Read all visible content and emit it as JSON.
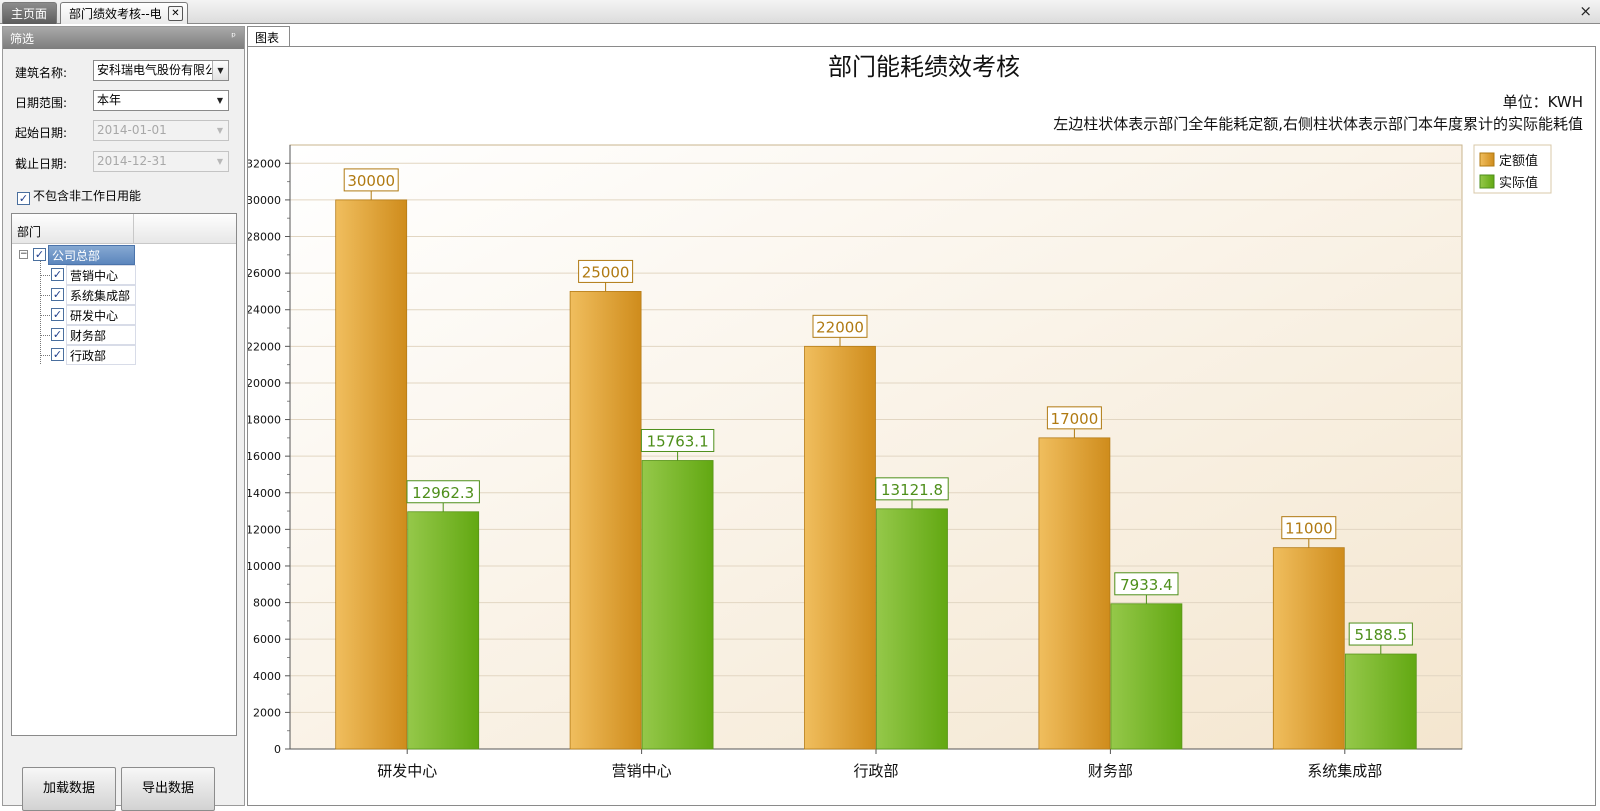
{
  "tabs": {
    "home": "主页面",
    "current": "部门绩效考核--电",
    "close_glyph": "✕",
    "window_close_glyph": "×"
  },
  "filter": {
    "title": "筛选",
    "pin_glyph": "ᵖ",
    "building_label": "建筑名称:",
    "building_value": "安科瑞电气股份有限公",
    "range_label": "日期范围:",
    "range_value": "本年",
    "start_label": "起始日期:",
    "start_value": "2014-01-01",
    "end_label": "截止日期:",
    "end_value": "2014-12-31",
    "exclude_label": "不包含非工作日用能",
    "exclude_checked": "✓"
  },
  "tree": {
    "column_header": "部门",
    "root": "公司总部",
    "children": [
      "营销中心",
      "系统集成部",
      "研发中心",
      "财务部",
      "行政部"
    ],
    "check_glyph": "✓",
    "collapse_glyph": "−"
  },
  "buttons": {
    "load": "加载数据",
    "export": "导出数据"
  },
  "chart_tab": "图表",
  "colors": {
    "quota": "#e0a33a",
    "actual": "#7ab62a",
    "quota_label": "#b07a12",
    "actual_label": "#4e8f1b"
  },
  "chart_data": {
    "type": "bar",
    "title": "部门能耗绩效考核",
    "unit_note": "单位：KWH",
    "subtitle": "左边柱状体表示部门全年能耗定额,右侧柱状体表示部门本年度累计的实际能耗值",
    "categories": [
      "研发中心",
      "营销中心",
      "行政部",
      "财务部",
      "系统集成部"
    ],
    "series": [
      {
        "name": "定额值",
        "values": [
          30000,
          25000,
          22000,
          17000,
          11000
        ],
        "labels": [
          "30000",
          "25000",
          "22000",
          "17000",
          "11000"
        ]
      },
      {
        "name": "实际值",
        "values": [
          12962.3,
          15763.1,
          13121.8,
          7933.4,
          5188.5
        ],
        "labels": [
          "12962.3",
          "15763.1",
          "13121.8",
          "7933.4",
          "5188.5"
        ]
      }
    ],
    "ylim": [
      0,
      33000
    ],
    "yticks": [
      "0",
      "2000",
      "4000",
      "6000",
      "8000",
      "10000",
      "12000",
      "14000",
      "16000",
      "18000",
      "20000",
      "22000",
      "24000",
      "26000",
      "28000",
      "30000",
      "32000"
    ],
    "grid": true,
    "legend": "top-right"
  }
}
